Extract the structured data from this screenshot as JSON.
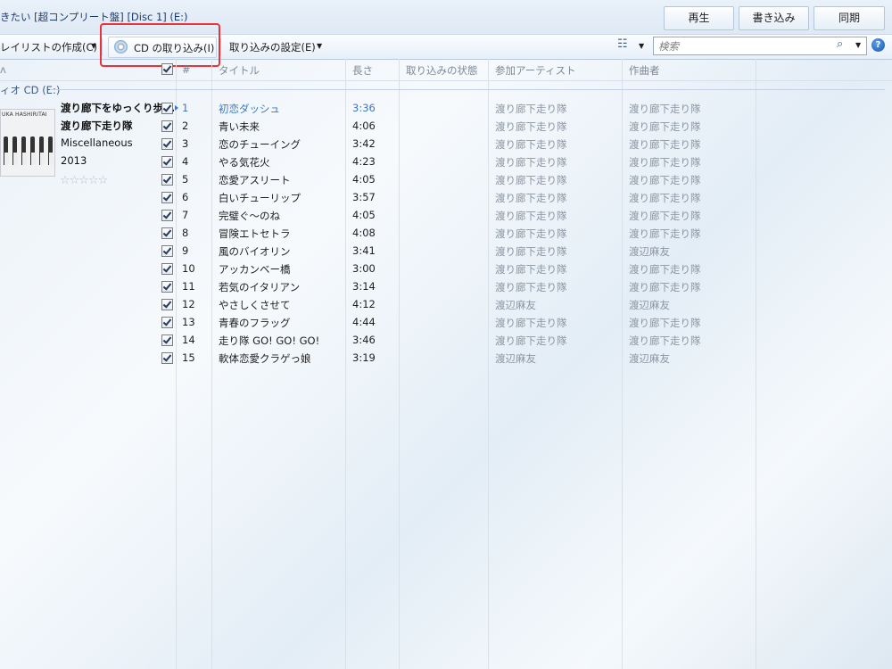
{
  "window": {
    "title": "きたい [超コンプリート盤] [Disc 1] (E:)",
    "tabs": [
      "再生",
      "書き込み",
      "同期"
    ]
  },
  "toolbar": {
    "create_playlist": "レイリストの作成(C)",
    "rip_cd": "CD の取り込み(I)",
    "rip_settings": "取り込みの設定(E)",
    "search_placeholder": "検索"
  },
  "columns": [
    "#",
    "タイトル",
    "長さ",
    "取り込みの状態",
    "参加アーティスト",
    "作曲者"
  ],
  "group_label": "ィオ CD (E:)",
  "album": {
    "art_text": "UKA HASHIRITAI",
    "title": "渡り廊下をゆっくり歩...",
    "artist": "渡り廊下走り隊",
    "genre": "Miscellaneous",
    "year": "2013",
    "rating_stars": "☆☆☆☆☆",
    "rating": 0
  },
  "tracks": [
    {
      "no": "1",
      "title": "初恋ダッシュ",
      "length": "3:36",
      "artist": "渡り廊下走り隊",
      "composer": "渡り廊下走り隊",
      "checked": true,
      "active": true
    },
    {
      "no": "2",
      "title": "青い未来",
      "length": "4:06",
      "artist": "渡り廊下走り隊",
      "composer": "渡り廊下走り隊",
      "checked": true
    },
    {
      "no": "3",
      "title": "恋のチューイング",
      "length": "3:42",
      "artist": "渡り廊下走り隊",
      "composer": "渡り廊下走り隊",
      "checked": true
    },
    {
      "no": "4",
      "title": "やる気花火",
      "length": "4:23",
      "artist": "渡り廊下走り隊",
      "composer": "渡り廊下走り隊",
      "checked": true
    },
    {
      "no": "5",
      "title": "恋愛アスリート",
      "length": "4:05",
      "artist": "渡り廊下走り隊",
      "composer": "渡り廊下走り隊",
      "checked": true
    },
    {
      "no": "6",
      "title": "白いチューリップ",
      "length": "3:57",
      "artist": "渡り廊下走り隊",
      "composer": "渡り廊下走り隊",
      "checked": true
    },
    {
      "no": "7",
      "title": "完璧ぐ～のね",
      "length": "4:05",
      "artist": "渡り廊下走り隊",
      "composer": "渡り廊下走り隊",
      "checked": true
    },
    {
      "no": "8",
      "title": "冒険エトセトラ",
      "length": "4:08",
      "artist": "渡り廊下走り隊",
      "composer": "渡り廊下走り隊",
      "checked": true
    },
    {
      "no": "9",
      "title": "風のバイオリン",
      "length": "3:41",
      "artist": "渡り廊下走り隊",
      "composer": "渡辺麻友",
      "checked": true
    },
    {
      "no": "10",
      "title": "アッカンベー橋",
      "length": "3:00",
      "artist": "渡り廊下走り隊",
      "composer": "渡り廊下走り隊",
      "checked": true
    },
    {
      "no": "11",
      "title": "若気のイタリアン",
      "length": "3:14",
      "artist": "渡り廊下走り隊",
      "composer": "渡り廊下走り隊",
      "checked": true
    },
    {
      "no": "12",
      "title": "やさしくさせて",
      "length": "4:12",
      "artist": "渡辺麻友",
      "composer": "渡辺麻友",
      "checked": true
    },
    {
      "no": "13",
      "title": "青春のフラッグ",
      "length": "4:44",
      "artist": "渡り廊下走り隊",
      "composer": "渡り廊下走り隊",
      "checked": true
    },
    {
      "no": "14",
      "title": "走り隊 GO! GO! GO!",
      "length": "3:46",
      "artist": "渡り廊下走り隊",
      "composer": "渡り廊下走り隊",
      "checked": true
    },
    {
      "no": "15",
      "title": "軟体恋愛クラゲっ娘",
      "length": "3:19",
      "artist": "渡辺麻友",
      "composer": "渡辺麻友",
      "checked": true
    }
  ],
  "colors": {
    "accent": "#3a78c3",
    "highlight_box": "#e8323c",
    "muted_text": "#8a96a3"
  }
}
